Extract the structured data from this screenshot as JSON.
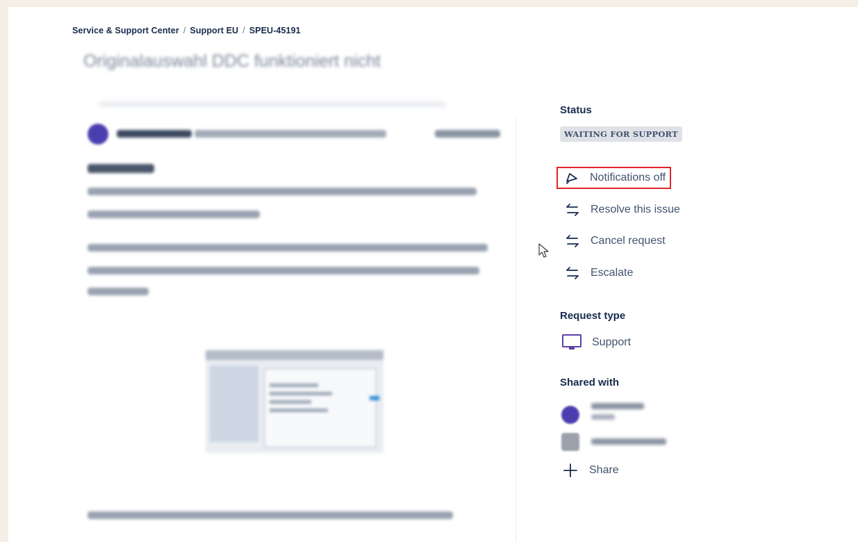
{
  "breadcrumb": {
    "items": [
      "Service & Support Center",
      "Support EU",
      "SPEU-45191"
    ],
    "separator": "/"
  },
  "issue": {
    "title": "Originalauswahl DDC funktioniert nicht"
  },
  "sidebar": {
    "status_label": "Status",
    "status_value": "WAITING FOR SUPPORT",
    "actions": [
      {
        "label": "Notifications off",
        "icon": "bell-off-icon"
      },
      {
        "label": "Resolve this issue",
        "icon": "transition-arrows-icon"
      },
      {
        "label": "Cancel request",
        "icon": "transition-arrows-icon"
      },
      {
        "label": "Escalate",
        "icon": "transition-arrows-icon"
      }
    ],
    "request_type_label": "Request type",
    "request_type_value": "Support",
    "shared_with_label": "Shared with",
    "share_label": "Share"
  },
  "colors": {
    "highlight": "#e0232b",
    "text": "#172b4d",
    "muted": "#42526e",
    "lozenge": "#dfe1e6",
    "avatar": "#4b3fb0",
    "request_icon": "#5e3ea8"
  }
}
